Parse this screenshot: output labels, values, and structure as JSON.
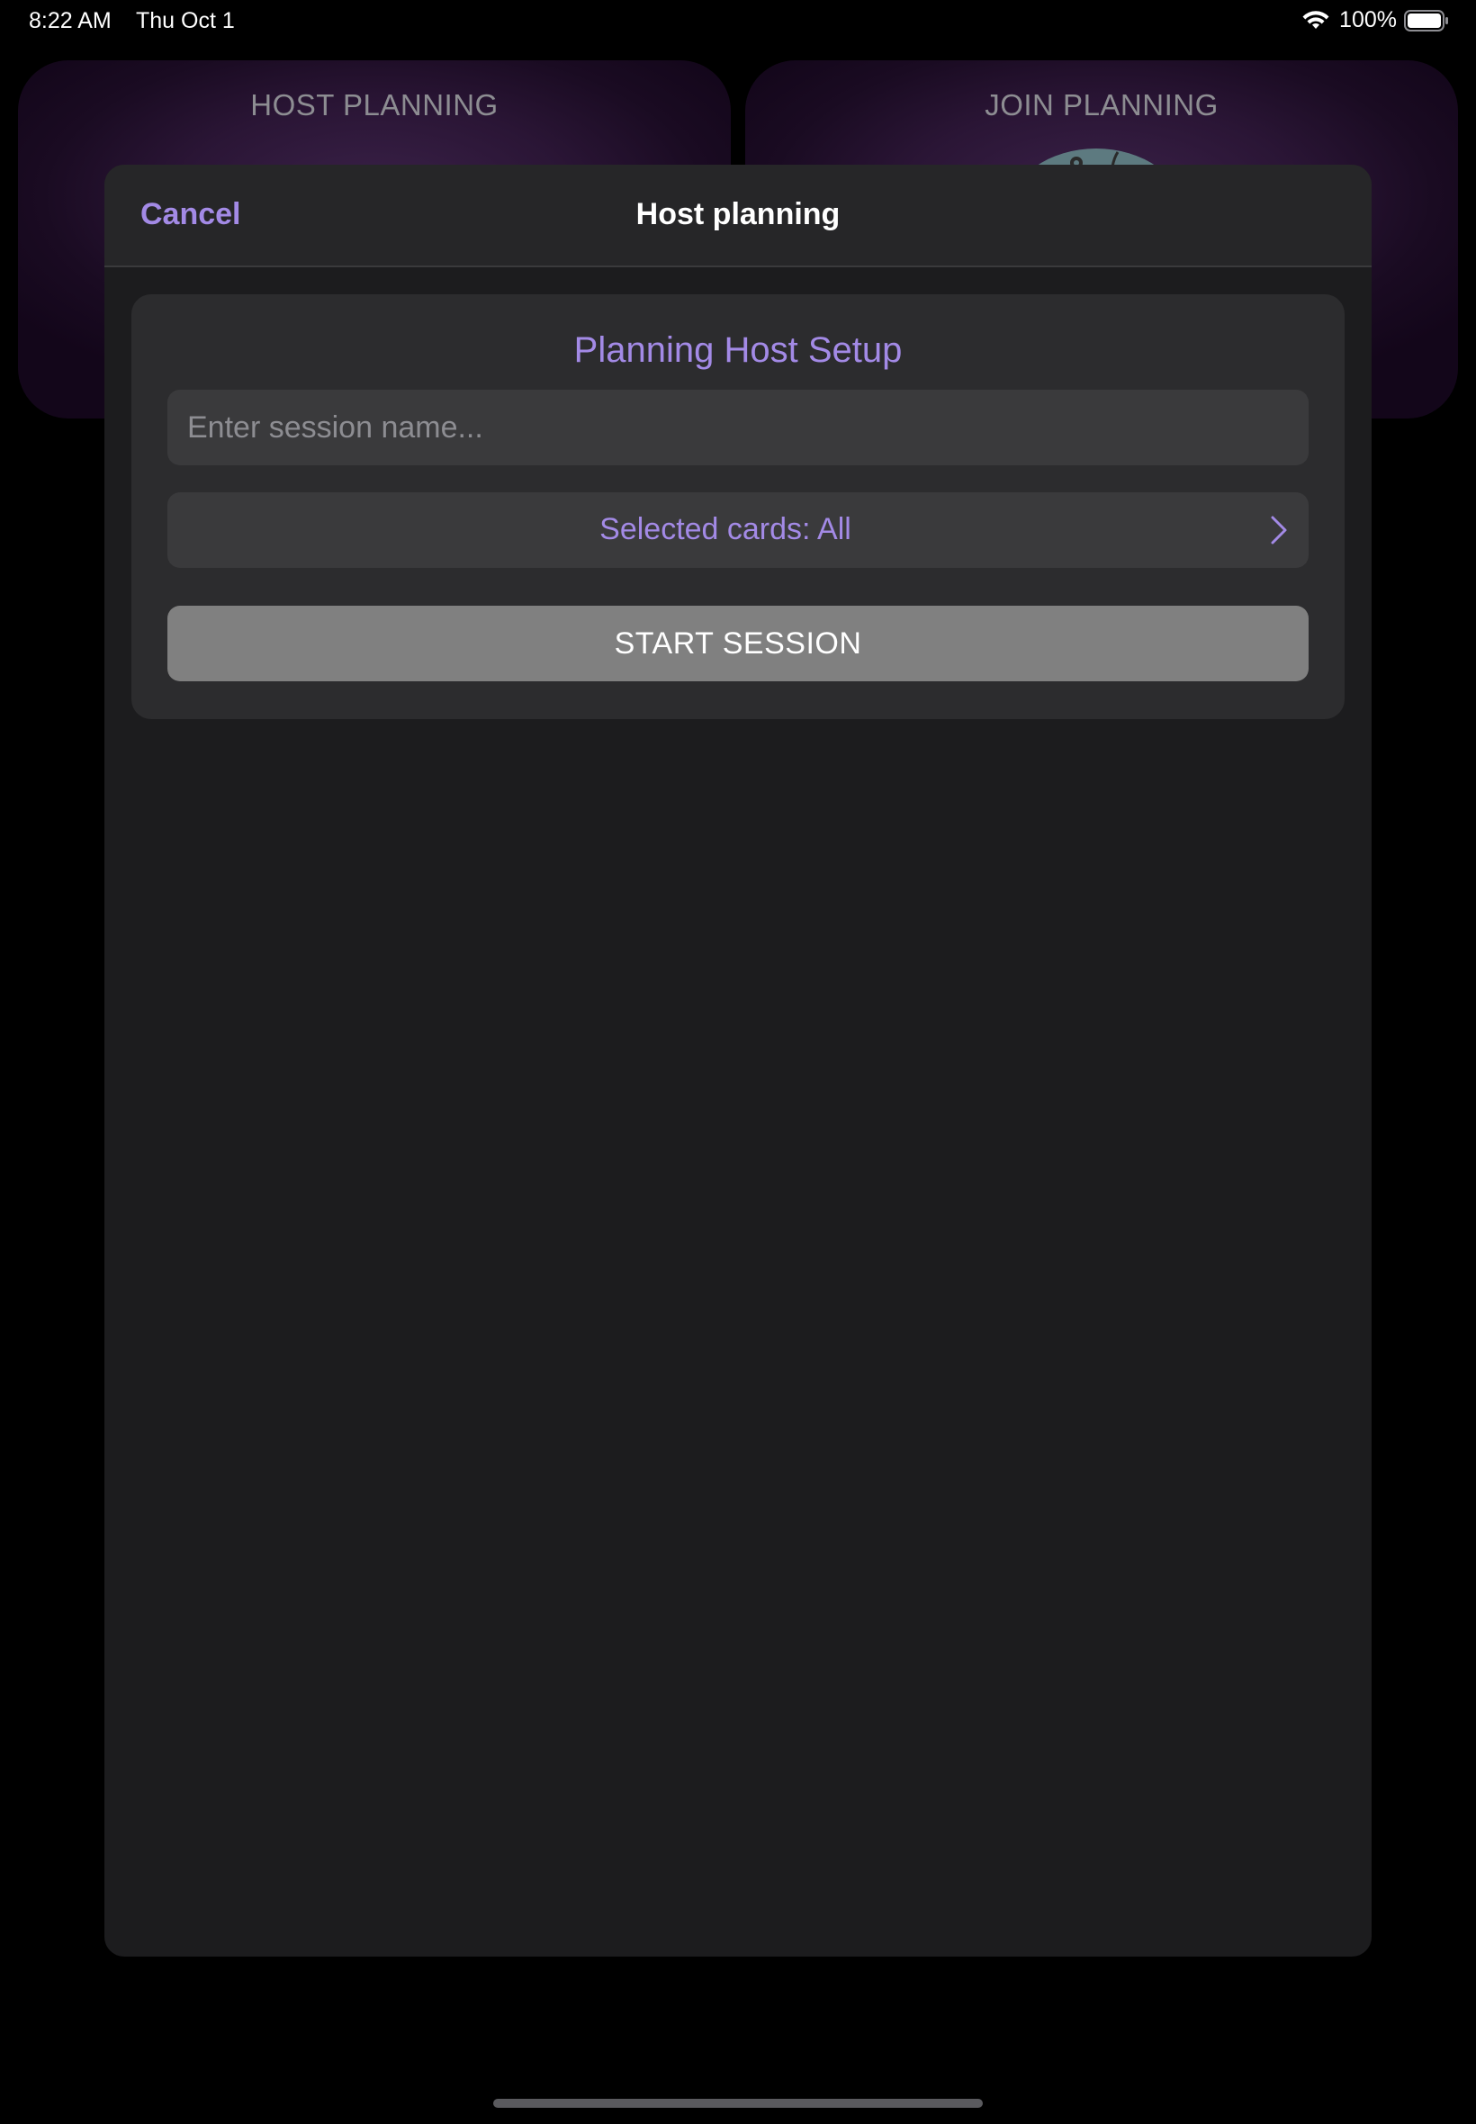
{
  "status_bar": {
    "time": "8:22 AM",
    "date": "Thu Oct 1",
    "battery_percent": "100%",
    "icons": [
      "wifi-icon",
      "battery-icon"
    ]
  },
  "background": {
    "host_card_title": "HOST PLANNING",
    "join_card_title": "JOIN PLANNING"
  },
  "sheet": {
    "nav": {
      "cancel_label": "Cancel",
      "title": "Host planning"
    },
    "setup": {
      "title": "Planning Host Setup",
      "session_name_value": "",
      "session_name_placeholder": "Enter session name...",
      "selected_cards_label": "Selected cards: All",
      "start_button_label": "START SESSION"
    }
  },
  "colors": {
    "accent": "#a38ae6",
    "sheet_background": "#1c1c1e",
    "group_background": "#2c2c2e",
    "field_background": "#3a3a3c",
    "start_button": "#808080",
    "card_purple": "#3a2148"
  }
}
